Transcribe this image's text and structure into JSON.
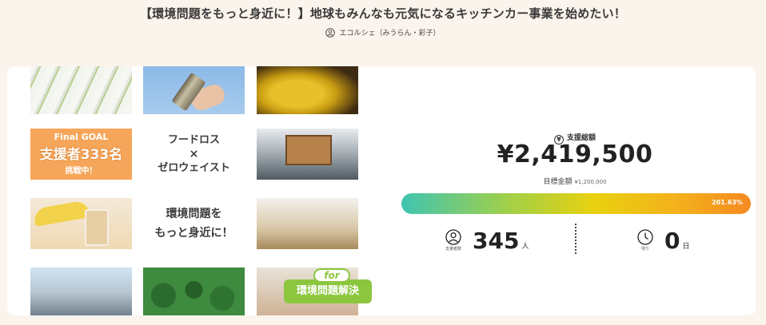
{
  "header": {
    "title": "【環境問題をもっと身近に！】地球もみんなも元気になるキッチンカー事業を始めたい！",
    "owner": "エコルシェ（みうらん・彩子）"
  },
  "gallery": {
    "goal_line1": "Final GOAL",
    "goal_line2": "支援者333名",
    "goal_line3": "挑戦中！",
    "foodloss_line1": "フードロス",
    "foodloss_x": "×",
    "foodloss_line2": "ゼロウェイスト",
    "env_line1": "環境問題を",
    "env_line2": "もっと身近に！",
    "badge_for": "for",
    "badge_label": "環境問題解決"
  },
  "stats": {
    "total_label": "支援総額",
    "yen_symbol": "¥",
    "total_amount": "¥2,419,500",
    "target_label": "目標金額",
    "target_amount": "¥1,200,000",
    "progress_text": "201.63%",
    "progress_value": 201.63,
    "supporters_caption": "支援者数",
    "supporters_count": "345",
    "supporters_unit": "人",
    "days_caption": "残り",
    "days_count": "0",
    "days_unit": "日"
  },
  "colors": {
    "accent_green": "#8cc63f",
    "goal_orange": "#f6a65a",
    "background": "#fbf4ec"
  }
}
